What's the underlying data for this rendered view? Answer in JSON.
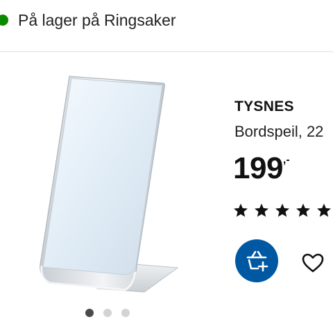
{
  "stock": {
    "status_text": "På lager på Ringsaker",
    "dot_color": "#0a8a00",
    "icon": "stock-status-dot"
  },
  "product": {
    "name": "TYSNES",
    "description": "Bordspeil, 22",
    "price_integer": "199",
    "price_suffix": ",-",
    "rating_stars": 5,
    "rating_max": 5,
    "image_icon": "table-mirror-image"
  },
  "carousel": {
    "count": 3,
    "active_index": 0
  },
  "actions": {
    "add_to_cart_icon": "basket-plus-icon",
    "add_to_cart_color": "#0058a3",
    "favourite_icon": "heart-outline-icon"
  }
}
